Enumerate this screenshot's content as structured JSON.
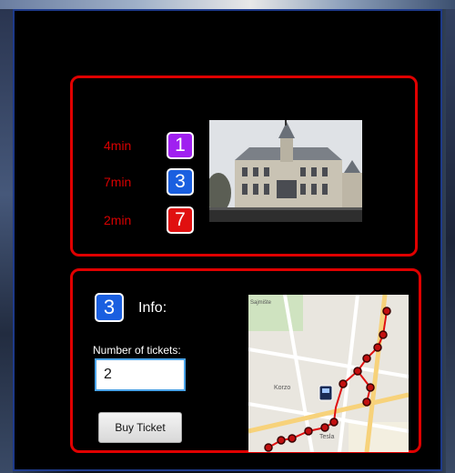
{
  "routes": [
    {
      "eta": "4min",
      "line": "1",
      "color": "#a020f0"
    },
    {
      "eta": "7min",
      "line": "3",
      "color": "#1a5fe0"
    },
    {
      "eta": "2min",
      "line": "7",
      "color": "#e01010"
    }
  ],
  "info": {
    "line": "3",
    "label": "Info:",
    "tickets_label": "Number of tickets:",
    "tickets_value": "2",
    "buy_label": "Buy Ticket"
  },
  "map": {
    "labels": [
      "Korzo",
      "Tesla",
      "Sajmište"
    ],
    "route_color": "#e01010"
  },
  "colors": {
    "panel_border": "#e00000",
    "eta_text": "#d80000",
    "dialog_border": "#1e3a8a"
  }
}
